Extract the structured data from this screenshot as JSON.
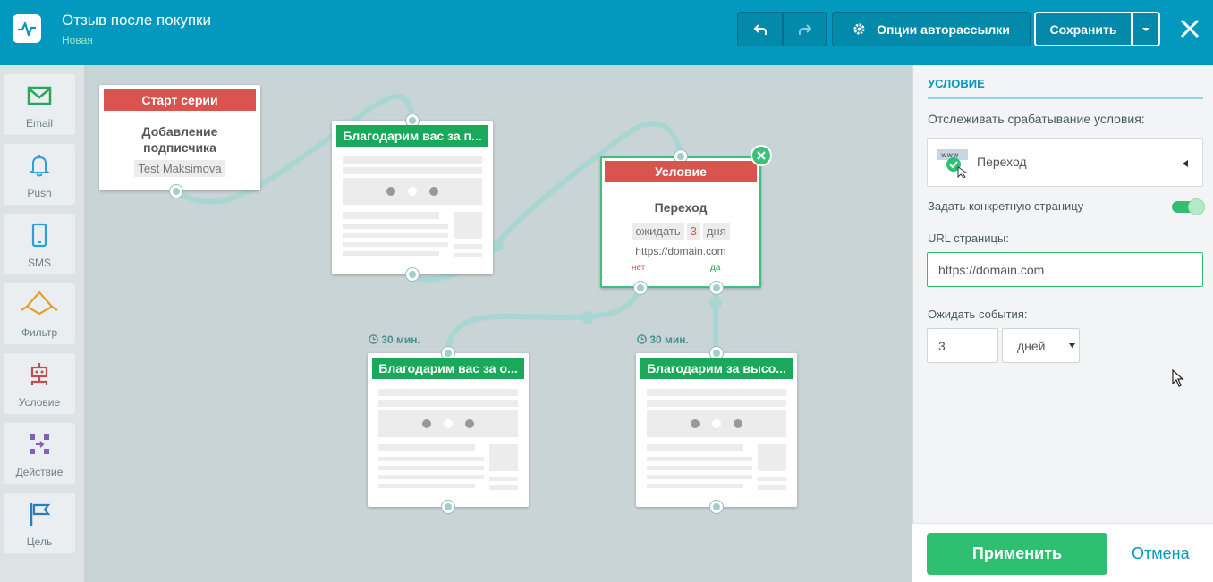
{
  "header": {
    "title": "Отзыв после покупки",
    "status": "Новая",
    "options_label": "Опции авторассылки",
    "save_label": "Сохранить"
  },
  "sidebar": {
    "items": [
      {
        "label": "Email",
        "icon": "envelope-icon"
      },
      {
        "label": "Push",
        "icon": "bell-icon"
      },
      {
        "label": "SMS",
        "icon": "phone-icon"
      },
      {
        "label": "Фильтр",
        "icon": "filter-icon"
      },
      {
        "label": "Условие",
        "icon": "condition-icon"
      },
      {
        "label": "Действие",
        "icon": "action-icon"
      },
      {
        "label": "Цель",
        "icon": "flag-icon"
      }
    ]
  },
  "canvas": {
    "start": {
      "header": "Старт серии",
      "title": "Добавление подписчика",
      "tag": "Test Maksimova"
    },
    "email1": {
      "header": "Благодарим вас за п..."
    },
    "condition": {
      "header": "Условие",
      "title": "Переход",
      "wait_label": "ожидать",
      "wait_value": "3",
      "wait_unit": "дня",
      "url": "https://domain.com",
      "no_label": "нет",
      "yes_label": "да"
    },
    "email2": {
      "header": "Благодарим вас за о...",
      "delay": "30 мин."
    },
    "email3": {
      "header": "Благодарим за высо...",
      "delay": "30 мин."
    }
  },
  "panel": {
    "section_title": "УСЛОВИЕ",
    "track_label": "Отслеживать срабатывание условия:",
    "track_value": "Переход",
    "specific_page_label": "Задать конкретную страницу",
    "specific_page_on": true,
    "url_label": "URL страницы:",
    "url_value": "https://domain.com",
    "wait_label": "Ожидать события:",
    "wait_value": "3",
    "wait_unit": "дней",
    "apply_label": "Применить",
    "cancel_label": "Отмена"
  },
  "colors": {
    "header": "#0398bd",
    "green": "#1aa85a",
    "red": "#d9534f",
    "apply": "#2fbf71",
    "link": "#0398bd"
  }
}
